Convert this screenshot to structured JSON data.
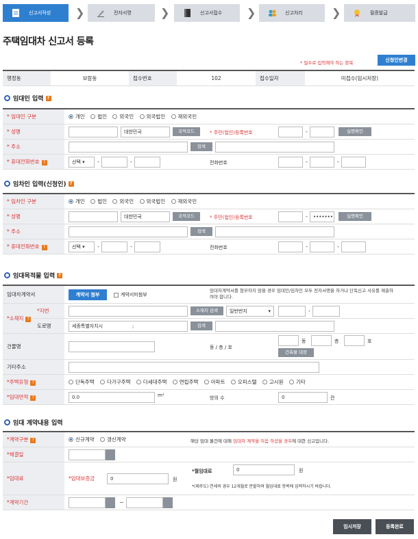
{
  "steps": [
    {
      "label": "신고서작성"
    },
    {
      "label": "전자서명"
    },
    {
      "label": "신고서접수"
    },
    {
      "label": "신고처리"
    },
    {
      "label": "필증발급"
    }
  ],
  "page_title": "주택임대차 신고서 등록",
  "required_note": "* 필수로 입력해야 하는 항목",
  "change_applicant_btn": "신청인변경",
  "info": {
    "h1": "행정동",
    "v1": "보람동",
    "h2": "접수번호",
    "v2": "102",
    "h3": "접수일자",
    "v3": "미접수(임시저장)"
  },
  "lessor": {
    "title": "임대인 입력",
    "type_label": "* 임대인 구분",
    "types": [
      "개인",
      "법인",
      "외국인",
      "외국법인",
      "재외국민"
    ],
    "name_label": "* 성명",
    "nation": "대한민국",
    "nation_btn": "국적코드",
    "rrn_label": "* 주민(법인)등록번호",
    "verify_btn": "실명확인",
    "addr_label": "* 주소",
    "search_btn": "검색",
    "mobile_label": "* 휴대전화번호",
    "select": "선택",
    "phone_label": "전화번호"
  },
  "lessee": {
    "title": "임차인 입력(신청인)",
    "type_label": "* 임차인 구분",
    "types": [
      "개인",
      "법인",
      "외국인",
      "외국법인",
      "재외국민"
    ],
    "name_label": "* 성명",
    "nation": "대한민국",
    "nation_btn": "국적코드",
    "rrn_label": "* 주민(법인)등록번호",
    "rrn_masked": "•••••••",
    "verify_btn": "실명확인",
    "addr_label": "* 주소",
    "search_btn": "검색",
    "mobile_label": "* 휴대전화번호",
    "select": "선택",
    "phone_label": "전화번호"
  },
  "property": {
    "title": "임대목적물 입력",
    "contract_label": "임대차계약서",
    "attach_btn": "계약서 첨부",
    "no_attach": "계약서미첨부",
    "attach_note": "임대차계약서를 첨부하지 않을 경우 임대인/임차인 모두 전자서명을 하거나 단독신고 사유를 제출하여야 합니다.",
    "location_label": "*소재지",
    "jibun_label": "*지번",
    "addr_search_btn": "소재지 검색",
    "jibun_select": "일반번지",
    "road_label": "도로명",
    "road_value": "세종특별자치시",
    "road_sep": ";",
    "search_btn": "검색",
    "bldg_label": "건물명",
    "dong_label": "동 / 층 / 호",
    "dong": "동",
    "floor": "층",
    "ho": "호",
    "bldg_btn": "건축물 대장",
    "extra_label": "기타주소",
    "house_type_label": "*주택유형",
    "house_types": [
      "단독주택",
      "다가구주택",
      "다세대주택",
      "연립주택",
      "아파트",
      "오피스텔",
      "고시원",
      "기타"
    ],
    "area_label": "*임대면적",
    "area_value": "0.0",
    "area_unit": "m²",
    "rooms_label": "방의 수",
    "rooms_value": "0",
    "rooms_unit": "칸"
  },
  "contract": {
    "title": "임대 계약내용 입력",
    "type_label": "*계약구분",
    "types": [
      "신규계약",
      "갱신계약"
    ],
    "type_note_pre": "해당 임대 물건에 대해",
    "type_note_red": "임대차 계약을 처음 하셨을 경우",
    "type_note_post": "에 대한 신고입니다.",
    "date_label": "*체결일",
    "rent_label": "*임대료",
    "deposit_label": "*임대보증금",
    "deposit_value": "0",
    "won": "원",
    "monthly_label": "*월임대료",
    "monthly_value": "0",
    "monthly_note": "*(제주도) 연세의 경우 12개월로 분할하여 월임대료 항목에 입력하시기 바랍니다.",
    "period_label": "*계약기간",
    "tilde": "~"
  },
  "buttons": {
    "temp_save": "임시저장",
    "submit": "등록완료"
  }
}
